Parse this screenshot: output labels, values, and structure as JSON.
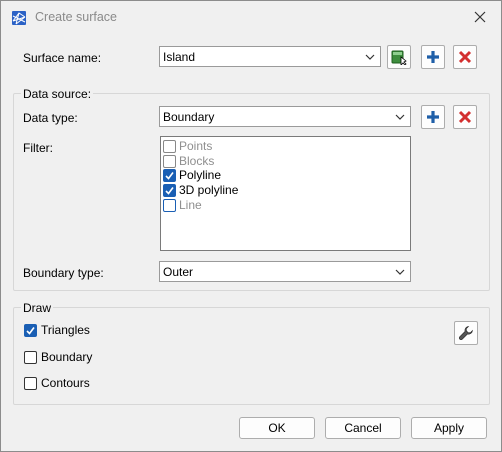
{
  "window": {
    "title": "Create surface"
  },
  "surface": {
    "label": "Surface name:",
    "value": "Island"
  },
  "data_source": {
    "group_label": "Data source:",
    "data_type_label": "Data type:",
    "data_type_value": "Boundary",
    "filter_label": "Filter:",
    "filter_items": [
      {
        "label": "Points",
        "checked": false,
        "enabled": false
      },
      {
        "label": "Blocks",
        "checked": false,
        "enabled": false
      },
      {
        "label": "Polyline",
        "checked": true,
        "enabled": true
      },
      {
        "label": "3D polyline",
        "checked": true,
        "enabled": true
      },
      {
        "label": "Line",
        "checked": false,
        "enabled": false
      }
    ],
    "boundary_type_label": "Boundary type:",
    "boundary_type_value": "Outer"
  },
  "draw": {
    "group_label": "Draw",
    "options": [
      {
        "label": "Triangles",
        "checked": true
      },
      {
        "label": "Boundary",
        "checked": false
      },
      {
        "label": "Contours",
        "checked": false
      }
    ]
  },
  "buttons": {
    "ok": "OK",
    "cancel": "Cancel",
    "apply": "Apply"
  },
  "icons": {
    "app": "surface-grid-icon",
    "select": "surface-select-icon",
    "add": "plus-icon",
    "remove": "red-x-icon",
    "settings": "wrench-icon"
  },
  "colors": {
    "accent": "#1a5fb4",
    "add": "#1f5fa8",
    "remove": "#d32f2f",
    "select_green": "#3e8e3e"
  }
}
